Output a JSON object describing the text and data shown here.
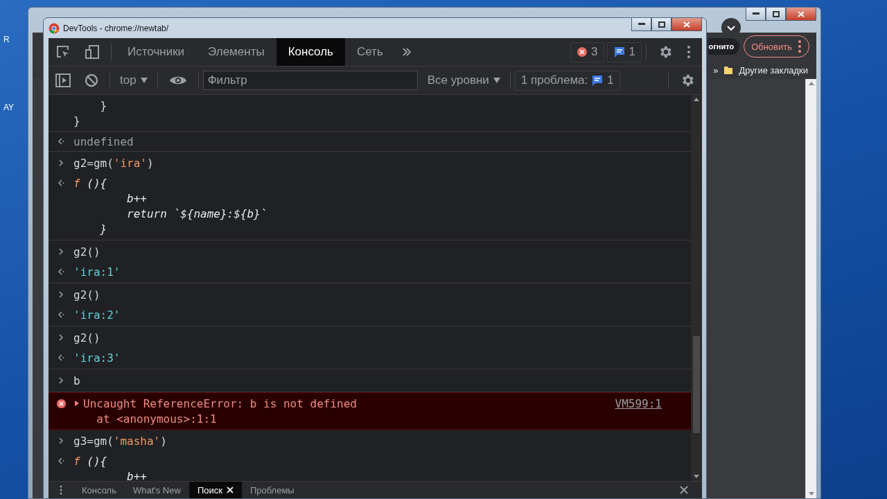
{
  "desktop_labels": [
    "R",
    "AY"
  ],
  "background_window": {
    "profile_label": "огнито",
    "update_button": "Обновить",
    "bookmarks_overflow": "»",
    "bookmark_folder": "Другие закладки"
  },
  "window": {
    "title": "DevTools - chrome://newtab/"
  },
  "tabs": [
    {
      "label": "Источники",
      "selected": false
    },
    {
      "label": "Элементы",
      "selected": false
    },
    {
      "label": "Консоль",
      "selected": true
    },
    {
      "label": "Сеть",
      "selected": false
    }
  ],
  "counters": {
    "errors": "3",
    "messages": "1"
  },
  "console_toolbar": {
    "context": "top",
    "filter_placeholder": "Фильтр",
    "levels": "Все уровни",
    "issues_label": "1 проблема:",
    "issues_count": "1"
  },
  "console": [
    {
      "kind": "continuation",
      "lines": [
        [
          {
            "text": "    }",
            "kind": "plain"
          }
        ],
        [
          {
            "text": "}",
            "kind": "plain"
          }
        ]
      ]
    },
    {
      "kind": "result",
      "lines": [
        [
          {
            "text": "undefined",
            "kind": "dim"
          }
        ]
      ]
    },
    {
      "kind": "input",
      "input": [
        {
          "text": "g2=gm(",
          "kind": "plain"
        },
        {
          "text": "'ira'",
          "kind": "string"
        },
        {
          "text": ")",
          "kind": "plain"
        }
      ],
      "lines": [
        [
          {
            "text": "f",
            "kind": "fn"
          },
          {
            "text": " (){",
            "kind": "body"
          }
        ],
        [
          {
            "text": "        b++",
            "kind": "body"
          }
        ],
        [
          {
            "text": "        return `${name}:${b}`",
            "kind": "body"
          }
        ],
        [
          {
            "text": "    }",
            "kind": "body"
          }
        ]
      ]
    },
    {
      "kind": "input",
      "input": [
        {
          "text": "g2()",
          "kind": "plain"
        }
      ],
      "lines": [
        [
          {
            "text": "'ira:1'",
            "kind": "value"
          }
        ]
      ]
    },
    {
      "kind": "input",
      "input": [
        {
          "text": "g2()",
          "kind": "plain"
        }
      ],
      "lines": [
        [
          {
            "text": "'ira:2'",
            "kind": "value"
          }
        ]
      ]
    },
    {
      "kind": "input",
      "input": [
        {
          "text": "g2()",
          "kind": "plain"
        }
      ],
      "lines": [
        [
          {
            "text": "'ira:3'",
            "kind": "value"
          }
        ]
      ]
    },
    {
      "kind": "input",
      "input": [
        {
          "text": "b",
          "kind": "plain"
        }
      ]
    },
    {
      "kind": "error",
      "expanded": false,
      "message": "Uncaught ReferenceError: b is not defined",
      "stack": "at <anonymous>:1:1",
      "source": "VM599:1"
    },
    {
      "kind": "input",
      "input": [
        {
          "text": "g3=gm(",
          "kind": "plain"
        },
        {
          "text": "'masha'",
          "kind": "string"
        },
        {
          "text": ")",
          "kind": "plain"
        }
      ],
      "lines": [
        [
          {
            "text": "f",
            "kind": "fn"
          },
          {
            "text": " (){",
            "kind": "body"
          }
        ],
        [
          {
            "text": "        b++",
            "kind": "body"
          }
        ]
      ]
    }
  ],
  "drawer_tabs": [
    {
      "label": "Консоль",
      "selected": false,
      "closable": false
    },
    {
      "label": "What's New",
      "selected": false,
      "closable": false
    },
    {
      "label": "Поиск",
      "selected": true,
      "closable": true
    },
    {
      "label": "Проблемы",
      "selected": false,
      "closable": false
    }
  ]
}
